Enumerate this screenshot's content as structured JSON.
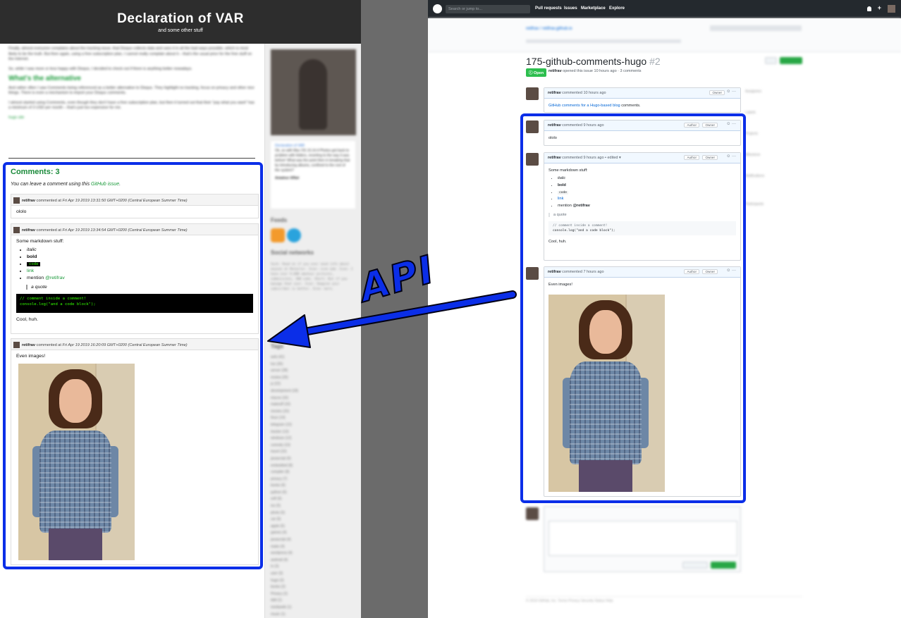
{
  "blog": {
    "title": "Declaration of VAR",
    "subtitle": "and some other stuff",
    "article_p1": "Finally, almost everyone complains about the tracking issue, that Disqus collects data and uses it in all the bad ways possible, which is most likely to be the truth. But then again, using a free subscription plan, I cannot really complain about it – that's the usual price for the free stuff on the internet.",
    "article_p2": "So, while I was more or less happy with Disqus, I decided to check out if there is anything better nowadays.",
    "article_h": "What's the alternative",
    "article_p3": "And rather often I saw Commento being referenced as a better alternative to Disqus. They highlight no tracking, focus on privacy and other nice things. There is even a mechanism to import your Disqus comments.",
    "article_p4": "I almost started using Commento, even though they don't have a free subscription plan, but then it turned out that their \"pay what you want\" has a minimum of 3 USD per month – that's just too expensive for me.",
    "article_tag": "hugo site",
    "sidebar_card_title": "Declaration of VAR",
    "sidebar_card_text": "Ok, so with Mac OS 10.14.4 Photos got back to problem with folders, reverting to the way it was before! What was the point then in breaking that by introducing albums, confined to the root of the system?",
    "sidebar_card_author": "Amateur Affair",
    "feeds_heading": "Feeds",
    "social_heading": "Social networks",
    "social_code": "Suck: Head on if you ever need info about anyone at Retailer. Icon: icon web. Icon: I have over 9,000 amateur pictures, submissions, 300 subs. Short: But if you manage that user. Icon: Imagine your subscriber is better. Icon: more.",
    "tags_heading": "Tags",
    "tags": [
      "web (41)",
      "fun (30)",
      "server (28)",
      "review (26)",
      "js (22)",
      "development (18)",
      "macos (16)",
      "makeuff (16)",
      "movies (15)",
      "linux (14)",
      "telegram (13)",
      "tracker (13)",
      "windows (12)",
      "comedy (10)",
      "travel (10)",
      "javascript (9)",
      "embedded (8)",
      "compiler (8)",
      "privacy (7)",
      "books (6)",
      "python (6)",
      "soft (6)",
      "ios (5)",
      "photo (5)",
      "car (5)",
      "apple (5)",
      "games (4)",
      "javascript (4)",
      "make (4)",
      "wordpress (4)",
      "android (4)",
      "tv (3)",
      "user (3)",
      "hugo (3)",
      "books (2)",
      "Privacy (2)",
      "ddd (1)",
      "mediawiki (1)",
      "music (1)"
    ]
  },
  "comments": {
    "title": "Comments: 3",
    "note_prefix": "You can leave a comment using this ",
    "note_link": "GitHub issue",
    "note_suffix": ".",
    "items": [
      {
        "author": "retifrav",
        "verb": " commented at ",
        "date": "Fri Apr 19 2019 13:31:50 GMT+0200 (Central European Summer Time)",
        "text": "ololo"
      },
      {
        "author": "retifrav",
        "verb": " commented at ",
        "date": "Fri Apr 19 2019 13:34:54 GMT+0200 (Central European Summer Time)",
        "intro": "Some markdown stuff:",
        "list": [
          "italic",
          "bold",
          "code",
          "link",
          "mention "
        ],
        "mention": "@retifrav",
        "quote": "a quote",
        "code_line1": "// comment inside a comment!",
        "code_line2": "console.log(\"and a code block\");",
        "outro": "Cool, huh."
      },
      {
        "author": "retifrav",
        "verb": " commented at ",
        "date": "Fri Apr 19 2019 16:20:09 GMT+0200 (Central European Summer Time)",
        "text": "Even images!"
      }
    ]
  },
  "api_label": "API",
  "github": {
    "search_placeholder": "Search or jump to...",
    "nav": [
      "Pull requests",
      "Issues",
      "Marketplace",
      "Explore"
    ],
    "repo_path": "retifrav / retifrav.github.io",
    "issue_title": "175-github-comments-hugo",
    "issue_number": "#2",
    "status": "Open",
    "meta_author": "retifrav",
    "meta_rest": " opened this issue 10 hours ago · 3 comments",
    "first_comment": {
      "author": "retifrav",
      "time": " commented 10 hours ago",
      "badge": "Owner",
      "link": "GitHub comments for a Hugo-based blog",
      "after": " comments."
    },
    "comments": [
      {
        "author": "retifrav",
        "time": " commented 9 hours ago",
        "badge_author": "Author",
        "badge_owner": "Owner",
        "text": "ololo"
      },
      {
        "author": "retifrav",
        "time": " commented 9 hours ago • edited ▾",
        "badge_author": "Author",
        "badge_owner": "Owner",
        "intro": "Some markdown stuff:",
        "list": [
          "italic",
          "bold",
          "code",
          "link",
          "mention "
        ],
        "mention": "@retifrav",
        "quote": "a quote",
        "code_line1": "// comment inside a comment!",
        "code_line2": "console.log(\"and a code block\");",
        "outro": "Cool, huh."
      },
      {
        "author": "retifrav",
        "time": " commented 7 hours ago",
        "badge_author": "Author",
        "badge_owner": "Owner",
        "text": "Even images!"
      }
    ],
    "side_labels": [
      "Assignees",
      "Labels",
      "Projects",
      "Milestone",
      "Notifications",
      "Participants"
    ],
    "footer": "© 2019 GitHub, Inc.  Terms  Privacy  Security  Status  Help"
  },
  "colors": {
    "highlight_blue": "#0b2ee8",
    "blog_accent": "#1a9a3a",
    "github_link": "#0366d6",
    "github_green": "#28a745"
  }
}
